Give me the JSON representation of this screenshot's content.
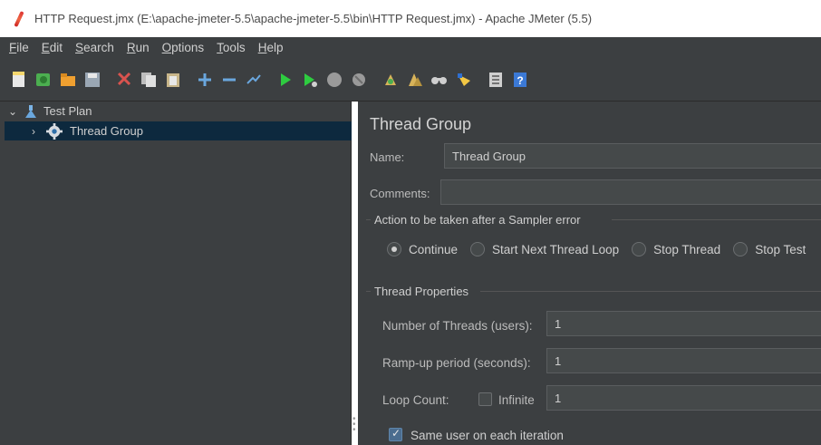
{
  "window": {
    "title": "HTTP Request.jmx (E:\\apache-jmeter-5.5\\apache-jmeter-5.5\\bin\\HTTP Request.jmx) - Apache JMeter (5.5)"
  },
  "menu": {
    "items": [
      "File",
      "Edit",
      "Search",
      "Run",
      "Options",
      "Tools",
      "Help"
    ]
  },
  "toolbar": {
    "icons": [
      {
        "name": "new-icon",
        "color": "#e8e8e8"
      },
      {
        "name": "templates-icon",
        "color": "#4caf50"
      },
      {
        "name": "open-icon",
        "color": "#f0a030"
      },
      {
        "name": "save-icon",
        "color": "#9aa7b4"
      },
      {
        "name": "cut-icon",
        "color": "#d9534f"
      },
      {
        "name": "copy-icon",
        "color": "#e0e0e0"
      },
      {
        "name": "paste-icon",
        "color": "#c8b68a"
      },
      {
        "name": "expand-icon",
        "color": "#6aa7de"
      },
      {
        "name": "collapse-icon",
        "color": "#6aa7de"
      },
      {
        "name": "toggle-icon",
        "color": "#6aa7de"
      },
      {
        "name": "start-icon",
        "color": "#2ecc40"
      },
      {
        "name": "start-no-pause-icon",
        "color": "#2ecc40"
      },
      {
        "name": "stop-icon",
        "color": "#9a9a9a"
      },
      {
        "name": "shutdown-icon",
        "color": "#9a9a9a"
      },
      {
        "name": "clear-icon",
        "color": "#d8b35a"
      },
      {
        "name": "clear-all-icon",
        "color": "#d8b35a"
      },
      {
        "name": "search-icon",
        "color": "#cfcfcf"
      },
      {
        "name": "reset-search-icon",
        "color": "#f2c744"
      },
      {
        "name": "function-helper-icon",
        "color": "#cfcfcf"
      },
      {
        "name": "help-icon",
        "color": "#3b79d6"
      }
    ]
  },
  "tree": {
    "root_label": "Test Plan",
    "child_label": "Thread Group"
  },
  "thread_group": {
    "title": "Thread Group",
    "name_label": "Name:",
    "name_value": "Thread Group",
    "comments_label": "Comments:",
    "comments_value": "",
    "error_action": {
      "legend": "Action to be taken after a Sampler error",
      "options": [
        "Continue",
        "Start Next Thread Loop",
        "Stop Thread",
        "Stop Test"
      ],
      "selected": "Continue"
    },
    "properties": {
      "legend": "Thread Properties",
      "threads_label": "Number of Threads (users):",
      "threads_value": "1",
      "rampup_label": "Ramp-up period (seconds):",
      "rampup_value": "1",
      "loop_label": "Loop Count:",
      "infinite_label": "Infinite",
      "infinite_checked": false,
      "loop_value": "1",
      "same_user_label": "Same user on each iteration",
      "same_user_checked": true
    }
  }
}
